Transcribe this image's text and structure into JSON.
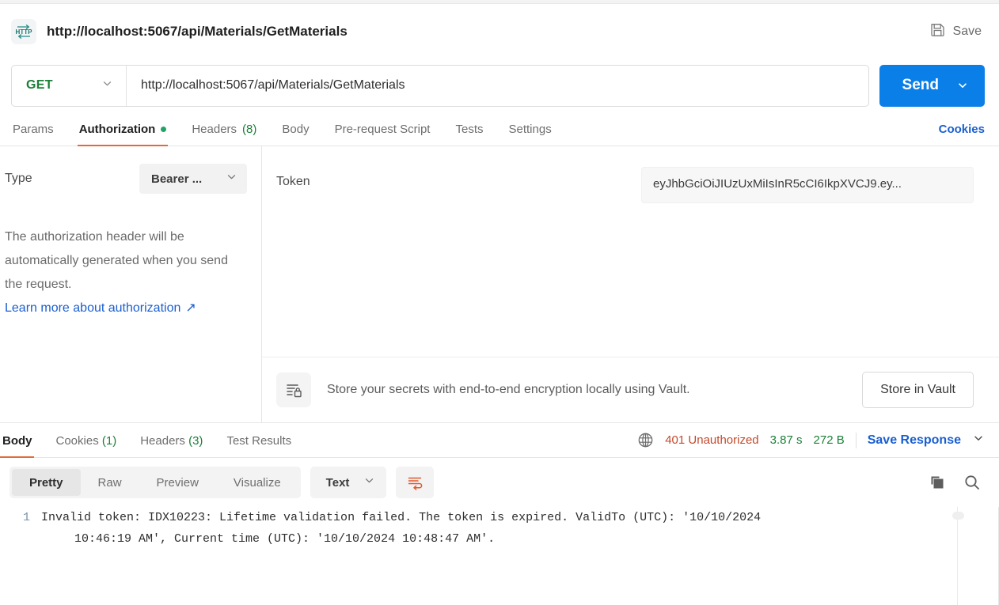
{
  "window": {
    "request_title": "http://localhost:5067/api/Materials/GetMaterials",
    "protocol_icon_text": "HTTP",
    "save_label": "Save"
  },
  "url_bar": {
    "method": "GET",
    "url": "http://localhost:5067/api/Materials/GetMaterials",
    "send_label": "Send"
  },
  "request_tabs": {
    "items": [
      {
        "label": "Params",
        "count": "",
        "active": false,
        "dot": false
      },
      {
        "label": "Authorization",
        "count": "",
        "active": true,
        "dot": true
      },
      {
        "label": "Headers",
        "count": "(8)",
        "active": false,
        "dot": false
      },
      {
        "label": "Body",
        "count": "",
        "active": false,
        "dot": false
      },
      {
        "label": "Pre-request Script",
        "count": "",
        "active": false,
        "dot": false
      },
      {
        "label": "Tests",
        "count": "",
        "active": false,
        "dot": false
      },
      {
        "label": "Settings",
        "count": "",
        "active": false,
        "dot": false
      }
    ],
    "cookies_label": "Cookies"
  },
  "authorization": {
    "type_label": "Type",
    "type_value": "Bearer ...",
    "note": "The authorization header will be automatically generated when you send the request.",
    "learn_more": "Learn more about authorization",
    "learn_more_arrow": "↗",
    "token_label": "Token",
    "token_value": "eyJhbGciOiJIUzUxMiIsInR5cCI6IkpXVCJ9.ey...",
    "vault_text": "Store your secrets with end-to-end encryption locally using Vault.",
    "vault_button": "Store in Vault"
  },
  "response_tabs": {
    "items": [
      {
        "label": "Body",
        "count": "",
        "active": true
      },
      {
        "label": "Cookies",
        "count": "(1)",
        "active": false
      },
      {
        "label": "Headers",
        "count": "(3)",
        "active": false
      },
      {
        "label": "Test Results",
        "count": "",
        "active": false
      }
    ],
    "status": "401 Unauthorized",
    "time": "3.87 s",
    "size": "272 B",
    "save_response": "Save Response"
  },
  "body_toolbar": {
    "views": [
      {
        "label": "Pretty",
        "active": true
      },
      {
        "label": "Raw",
        "active": false
      },
      {
        "label": "Preview",
        "active": false
      },
      {
        "label": "Visualize",
        "active": false
      }
    ],
    "format": "Text"
  },
  "response_body": {
    "line_number": "1",
    "line1": "Invalid token: IDX10223: Lifetime validation failed. The token is expired. ValidTo (UTC): '10/10/2024",
    "line2": "10:46:19 AM', Current time (UTC): '10/10/2024 10:48:47 AM'."
  },
  "colors": {
    "accent_blue": "#0b7fe8",
    "link_blue": "#1a5fd0",
    "success_green": "#1a7f37",
    "error_red": "#c4492b",
    "tab_underline": "#e06c3b",
    "wrap_icon": "#e0582b"
  }
}
